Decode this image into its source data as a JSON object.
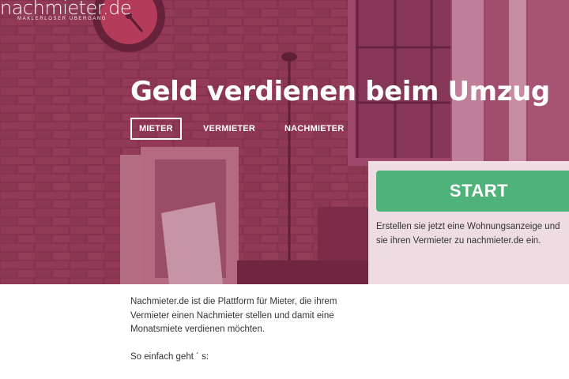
{
  "logo": {
    "name": "nachmieter.de",
    "tagline": "MAKLERLOSER ÜBERGANG"
  },
  "hero": {
    "headline": "Geld verdienen beim Umzug",
    "tabs": [
      {
        "label": "MIETER",
        "active": true
      },
      {
        "label": "VERMIETER",
        "active": false
      },
      {
        "label": "NACHMIETER",
        "active": false
      }
    ]
  },
  "panel": {
    "start_label": "START",
    "text_lines": [
      "Erstellen sie jetzt eine Wohnungsanzeige und",
      "sie ihren Vermieter zu nachmieter.de ein."
    ]
  },
  "content": {
    "intro_lines": [
      "Nachmieter.de ist die Plattform für Mieter, die ihrem",
      "Vermieter einen Nachmieter stellen und damit eine",
      "Monatsmiete verdienen möchten."
    ],
    "steps_heading": "So einfach geht ´ s:"
  },
  "colors": {
    "overlay": "#962855",
    "start_button": "#4fb27a",
    "panel": "#f6e8ee",
    "text": "#333333"
  }
}
